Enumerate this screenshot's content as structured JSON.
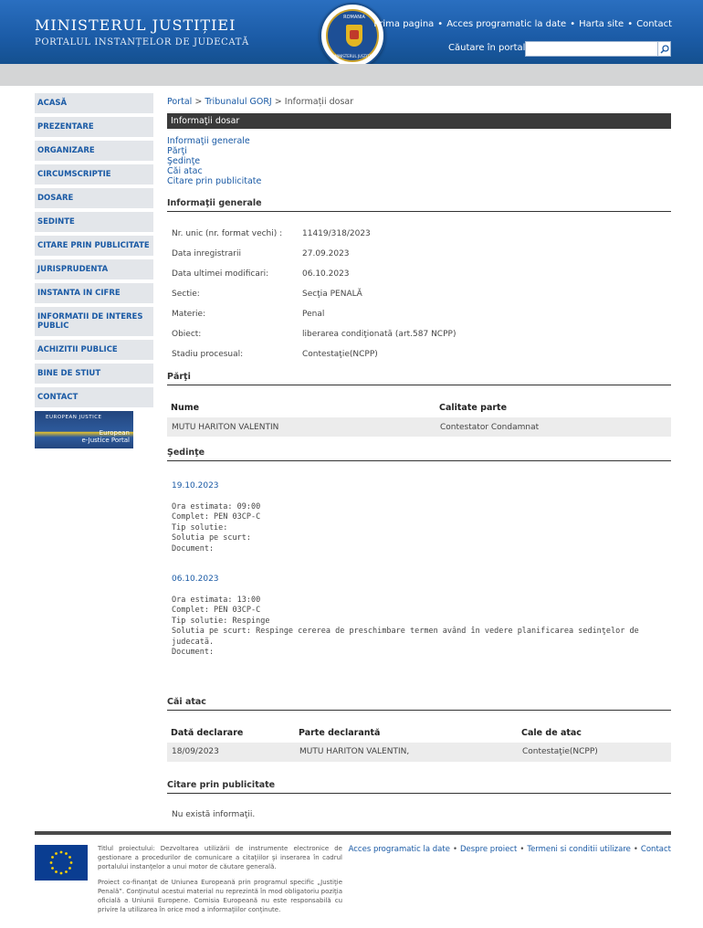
{
  "header": {
    "title_line1": "MINISTERUL JUSTIȚIEI",
    "title_line2": "PORTALUL INSTANȚELOR DE JUDECATĂ",
    "crest_top": "ROMANIA",
    "crest_bottom": "MINISTERUL JUSTITIEI",
    "nav": [
      "Prima pagina",
      "Acces programatic la date",
      "Harta site",
      "Contact"
    ],
    "search_label": "Căutare în portal",
    "search_value": ""
  },
  "sidebar": {
    "items": [
      {
        "label": "ACASĂ"
      },
      {
        "label": "PREZENTARE"
      },
      {
        "label": "ORGANIZARE"
      },
      {
        "label": "CIRCUMSCRIPTIE"
      },
      {
        "label": "DOSARE"
      },
      {
        "label": "SEDINTE"
      },
      {
        "label": "CITARE PRIN PUBLICITATE"
      },
      {
        "label": "JURISPRUDENTA"
      },
      {
        "label": "INSTANTA IN CIFRE"
      },
      {
        "label": "INFORMATII DE INTERES PUBLIC"
      },
      {
        "label": "ACHIZITII PUBLICE"
      },
      {
        "label": "BINE DE STIUT"
      },
      {
        "label": "CONTACT"
      }
    ],
    "ejustice": {
      "top": "EUROPEAN JUSTICE",
      "line1": "European",
      "line2": "e-Justice Portal"
    }
  },
  "breadcrumb": {
    "portal": "Portal",
    "court": "Tribunalul GORJ",
    "current": "Informații dosar",
    "sep": ">"
  },
  "info_bar": "Informaţii dosar",
  "toc": [
    "Informaţii generale",
    "Părţi",
    "Şedinţe",
    "Căi atac",
    "Citare prin publicitate"
  ],
  "general": {
    "title": "Informaţii generale",
    "rows": [
      {
        "k": "Nr. unic (nr. format vechi) :",
        "v": "11419/318/2023"
      },
      {
        "k": "Data inregistrarii",
        "v": "27.09.2023"
      },
      {
        "k": "Data ultimei modificari:",
        "v": "06.10.2023"
      },
      {
        "k": "Sectie:",
        "v": "Secţia PENALĂ"
      },
      {
        "k": "Materie:",
        "v": "Penal"
      },
      {
        "k": "Obiect:",
        "v": "liberarea condiţionată (art.587 NCPP)"
      },
      {
        "k": "Stadiu procesual:",
        "v": "Contestaţie(NCPP)"
      }
    ]
  },
  "parti": {
    "title": "Părţi",
    "headers": [
      "Nume",
      "Calitate parte"
    ],
    "rows": [
      [
        "MUTU HARITON VALENTIN",
        "Contestator Condamnat"
      ]
    ]
  },
  "sedinte": {
    "title": "Şedinţe",
    "items": [
      {
        "date": "19.10.2023",
        "ora": "Ora estimata: 09:00",
        "complet": "Complet: PEN 03CP-C",
        "tip": "Tip solutie:",
        "solutia": "Solutia pe scurt:",
        "document": "Document:"
      },
      {
        "date": "06.10.2023",
        "ora": "Ora estimata: 13:00",
        "complet": "Complet: PEN 03CP-C",
        "tip": "Tip solutie: Respinge",
        "solutia": "Solutia pe scurt: Respinge cererea de preschimbare termen având în vedere planificarea sedinţelor de judecată.",
        "document": "Document:"
      }
    ]
  },
  "cai_atac": {
    "title": "Căi atac",
    "headers": [
      "Dată declarare",
      "Parte declarantă",
      "Cale de atac"
    ],
    "rows": [
      [
        "18/09/2023",
        "MUTU HARITON VALENTIN,",
        "Contestaţie(NCPP)"
      ]
    ]
  },
  "citare": {
    "title": "Citare prin publicitate",
    "empty": "Nu există informaţii."
  },
  "footer": {
    "text1": "Titlul proiectului: Dezvoltarea utilizării de instrumente electronice de gestionare a procedurilor de comunicare a citaţiilor şi inserarea în cadrul portalului instanţelor a unui motor de căutare generală.",
    "text2": "Proiect co-finanţat de Uniunea Europeană prin programul specific „Justiţie Penală”. Conţinutul acestui material nu reprezintă în mod obligatoriu poziţia oficială a Uniunii Europene. Comisia Europeană nu este responsabilă cu privire la utilizarea în orice mod a informaţiilor conţinute.",
    "links": [
      "Acces programatic la date",
      "Despre proiect",
      "Termeni si conditii utilizare",
      "Contact"
    ]
  },
  "colors": {
    "header_blue": "#1b5ba6",
    "link_blue": "#1a5aa5",
    "dark_bar": "#3a3a3a",
    "row_gray": "#ececec"
  }
}
